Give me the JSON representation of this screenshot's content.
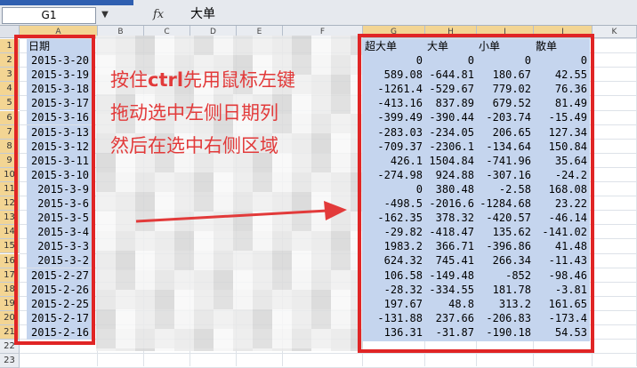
{
  "name_box": "G1",
  "fx_symbol": "fx",
  "formula_value": "大单",
  "column_letters": [
    "A",
    "B",
    "C",
    "D",
    "E",
    "F",
    "G",
    "H",
    "I",
    "J",
    "K"
  ],
  "row_numbers": [
    "1",
    "2",
    "3",
    "4",
    "5",
    "6",
    "7",
    "8",
    "9",
    "10",
    "11",
    "12",
    "13",
    "14",
    "15",
    "16",
    "17",
    "18",
    "19",
    "20",
    "21",
    "22",
    "23"
  ],
  "date_column": {
    "header": "日期",
    "values": [
      "2015-3-20",
      "2015-3-19",
      "2015-3-18",
      "2015-3-17",
      "2015-3-16",
      "2015-3-13",
      "2015-3-12",
      "2015-3-11",
      "2015-3-10",
      "2015-3-9",
      "2015-3-6",
      "2015-3-5",
      "2015-3-4",
      "2015-3-3",
      "2015-3-2",
      "2015-2-27",
      "2015-2-26",
      "2015-2-25",
      "2015-2-17",
      "2015-2-16"
    ]
  },
  "right_table": {
    "headers": [
      "超大单",
      "大单",
      "小单",
      "散单"
    ],
    "rows": [
      [
        "0",
        "0",
        "0",
        "0"
      ],
      [
        "589.08",
        "-644.81",
        "180.67",
        "42.55"
      ],
      [
        "-1261.4",
        "-529.67",
        "779.02",
        "76.36"
      ],
      [
        "-413.16",
        "837.89",
        "679.52",
        "81.49"
      ],
      [
        "-399.49",
        "-390.44",
        "-203.74",
        "-15.49"
      ],
      [
        "-283.03",
        "-234.05",
        "206.65",
        "127.34"
      ],
      [
        "-709.37",
        "-2306.1",
        "-134.64",
        "150.84"
      ],
      [
        "426.1",
        "1504.84",
        "-741.96",
        "35.64"
      ],
      [
        "-274.98",
        "924.88",
        "-307.16",
        "-24.2"
      ],
      [
        "0",
        "380.48",
        "-2.58",
        "168.08"
      ],
      [
        "-498.5",
        "-2016.6",
        "-1284.68",
        "23.22"
      ],
      [
        "-162.35",
        "378.32",
        "-420.57",
        "-46.14"
      ],
      [
        "-29.82",
        "-418.47",
        "135.62",
        "-141.02"
      ],
      [
        "1983.2",
        "366.71",
        "-396.86",
        "41.48"
      ],
      [
        "624.32",
        "745.41",
        "266.34",
        "-11.43"
      ],
      [
        "106.58",
        "-149.48",
        "-852",
        "-98.46"
      ],
      [
        "-28.32",
        "-334.55",
        "181.78",
        "-3.81"
      ],
      [
        "197.67",
        "48.8",
        "313.2",
        "161.65"
      ],
      [
        "-131.88",
        "237.66",
        "-206.83",
        "-173.4"
      ],
      [
        "136.31",
        "-31.87",
        "-190.18",
        "54.53"
      ]
    ]
  },
  "annotation": {
    "line1_pre": "按住",
    "line1_key": "ctrl",
    "line1_post": "先用鼠标左键",
    "line2": "拖动选中左侧日期列",
    "line3": "然后在选中右侧区域"
  },
  "colors": {
    "selection_fill": "#c5d5ee",
    "highlight_red": "#e02525",
    "annotation_red": "#e23a3a",
    "header_selected": "#f3d593"
  }
}
